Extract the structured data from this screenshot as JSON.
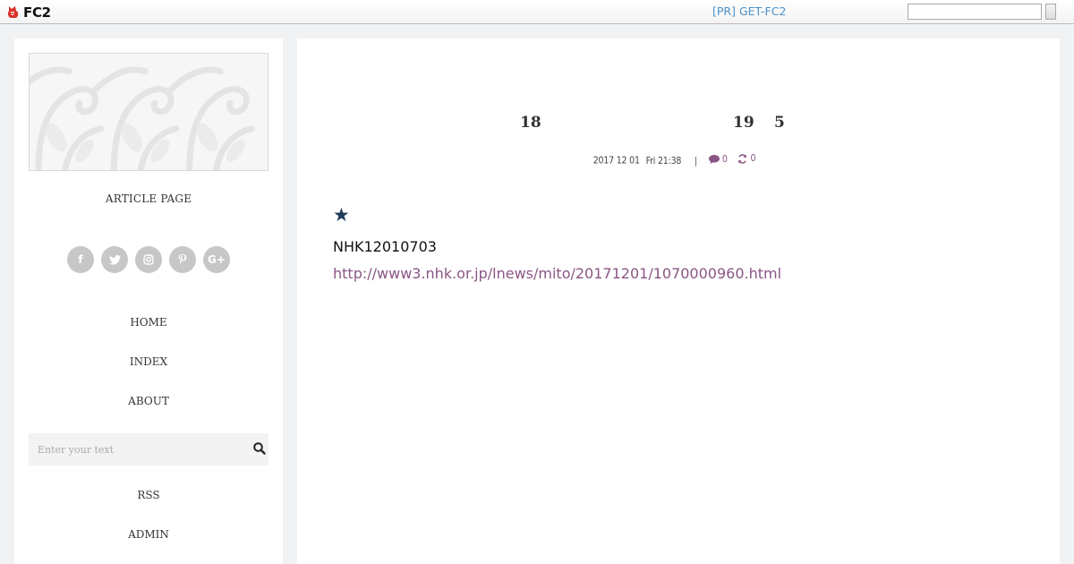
{
  "topbar": {
    "logo_text": "FC2",
    "pr_link": "[PR] GET-FC2",
    "search_value": ""
  },
  "sidebar": {
    "title": "ARTICLE PAGE",
    "social_icons": [
      "facebook-icon",
      "twitter-icon",
      "instagram-icon",
      "pinterest-icon",
      "google-plus-icon"
    ],
    "nav": {
      "home": "HOME",
      "index": "INDEX",
      "about": "ABOUT",
      "rss": "RSS",
      "admin": "ADMIN"
    },
    "search_placeholder": "Enter your text"
  },
  "article": {
    "title_parts": [
      "18",
      "19",
      "5"
    ],
    "meta": {
      "date": "2017 12 01",
      "weekday_time": "Fri 21:38",
      "separator": "|",
      "comments": "0",
      "trackbacks": "0"
    },
    "star": "★",
    "body_line": "NHK12010703",
    "link": "http://www3.nhk.or.jp/lnews/mito/20171201/1070000960.html"
  },
  "colors": {
    "accent": "#8a5585",
    "star": "#1e3c5a",
    "pr_link": "#4a90c8",
    "page_bg": "#f1f2f4"
  }
}
